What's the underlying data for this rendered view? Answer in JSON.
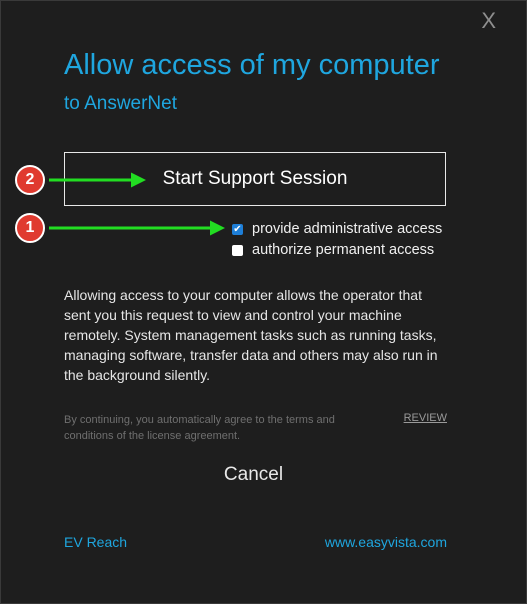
{
  "window": {
    "close_label": "X",
    "title": "Allow access of my computer",
    "subtitle": "to AnswerNet"
  },
  "session": {
    "start_label": "Start Support Session"
  },
  "options": {
    "admin_label": "provide administrative access",
    "admin_checked": true,
    "permanent_label": "authorize permanent access",
    "permanent_checked": false,
    "checkmark": "✔"
  },
  "description": "Allowing access to your computer allows the operator that sent you this request to view and control your machine remotely. System management tasks such as running tasks, managing software, transfer data and others may also run in the background silently.",
  "terms": {
    "text": "By continuing, you automatically agree to the terms and conditions of the license agreement.",
    "review_label": "REVIEW"
  },
  "cancel_label": "Cancel",
  "footer": {
    "left_link": "EV Reach",
    "right_link": "www.easyvista.com"
  },
  "annotations": {
    "marker_1": "1",
    "marker_2": "2",
    "arrow_color": "#22dd22",
    "marker_color": "#e03a2f"
  },
  "colors": {
    "accent": "#1fa6df",
    "background": "#1e1e1e",
    "checkbox_checked": "#1e7fd8"
  }
}
